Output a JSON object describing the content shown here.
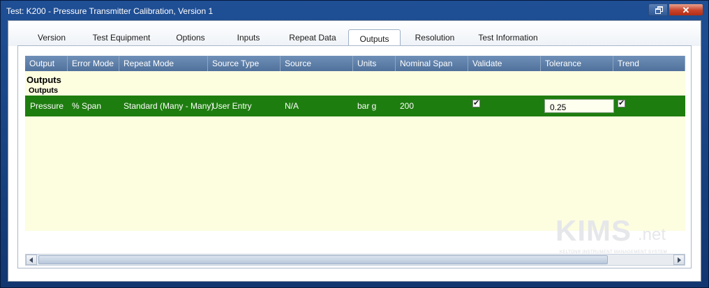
{
  "window": {
    "title": "Test: K200 - Pressure Transmitter Calibration, Version 1",
    "close_symbol": "✕"
  },
  "tabs": [
    {
      "label": "Version"
    },
    {
      "label": "Test Equipment"
    },
    {
      "label": "Options"
    },
    {
      "label": "Inputs"
    },
    {
      "label": "Repeat Data"
    },
    {
      "label": "Outputs",
      "active": true
    },
    {
      "label": "Resolution"
    },
    {
      "label": "Test Information"
    }
  ],
  "grid": {
    "columns": [
      "Output",
      "Error Mode",
      "Repeat Mode",
      "Source Type",
      "Source",
      "Units",
      "Nominal Span",
      "Validate",
      "Tolerance",
      "Trend"
    ],
    "group_title": "Outputs",
    "group_subtitle": "Outputs",
    "rows": [
      {
        "output": "Pressure",
        "error_mode": "% Span",
        "repeat_mode": "Standard (Many - Many)",
        "source_type": "User Entry",
        "source": "N/A",
        "units": "bar g",
        "nominal_span": "200",
        "validate": true,
        "tolerance": "0.25",
        "trend": true
      }
    ],
    "row_color": "#1e7d0f",
    "body_color": "#fdfde0"
  },
  "logo": {
    "main": "KIMS",
    "suffix": ".net",
    "tagline": "KELTON® INSTRUMENT MANAGEMENT SYSTEM"
  }
}
